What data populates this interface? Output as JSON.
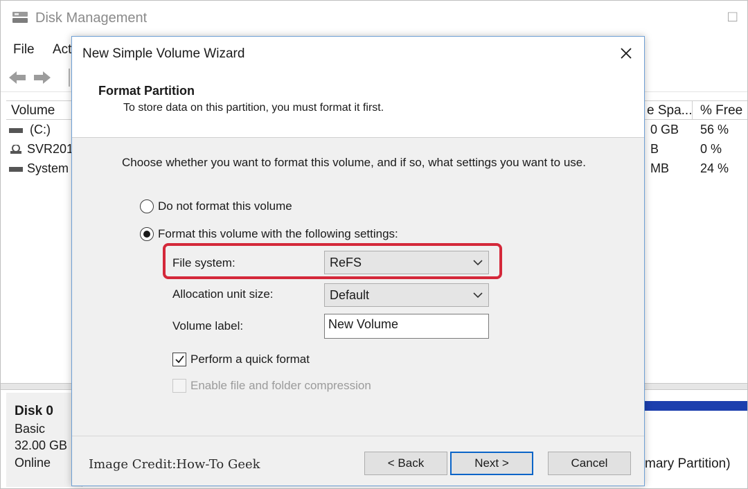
{
  "background_app": {
    "title": "Disk Management",
    "menu": [
      "File",
      "Act"
    ],
    "volume_table": {
      "columns": [
        "Volume",
        "e Spa...",
        "% Free"
      ],
      "rows": [
        {
          "volume": "(C:)",
          "free_space": "0 GB",
          "percent_free": "56 %"
        },
        {
          "volume": "SVR201",
          "free_space": "B",
          "percent_free": "0 %"
        },
        {
          "volume": "System",
          "free_space": "MB",
          "percent_free": "24 %"
        }
      ]
    },
    "disk": {
      "name": "Disk 0",
      "type": "Basic",
      "size": "32.00 GB",
      "status": "Online",
      "partition_text": "mary Partition)"
    },
    "colors": {
      "partition_bar": "#1c3fae"
    }
  },
  "wizard": {
    "title": "New Simple Volume Wizard",
    "close_icon": "close-icon",
    "header": {
      "title": "Format Partition",
      "subtitle": "To store data on this partition, you must format it first."
    },
    "intro": "Choose whether you want to format this volume, and if so, what settings you want to use.",
    "option_no_format": {
      "label": "Do not format this volume",
      "selected": false
    },
    "option_format": {
      "label": "Format this volume with the following settings:",
      "selected": true
    },
    "file_system": {
      "label": "File system:",
      "value": "ReFS"
    },
    "allocation_unit": {
      "label": "Allocation unit size:",
      "value": "Default"
    },
    "volume_label": {
      "label": "Volume label:",
      "value": "New Volume"
    },
    "quick_format": {
      "label": "Perform a quick format",
      "checked": true
    },
    "compression": {
      "label": "Enable file and folder compression",
      "checked": false,
      "enabled": false
    },
    "credit": "Image Credit:How-To Geek",
    "buttons": {
      "back": "< Back",
      "next": "Next >",
      "cancel": "Cancel"
    },
    "colors": {
      "highlight": "#d4283a",
      "default_button_border": "#0a64c8"
    }
  }
}
